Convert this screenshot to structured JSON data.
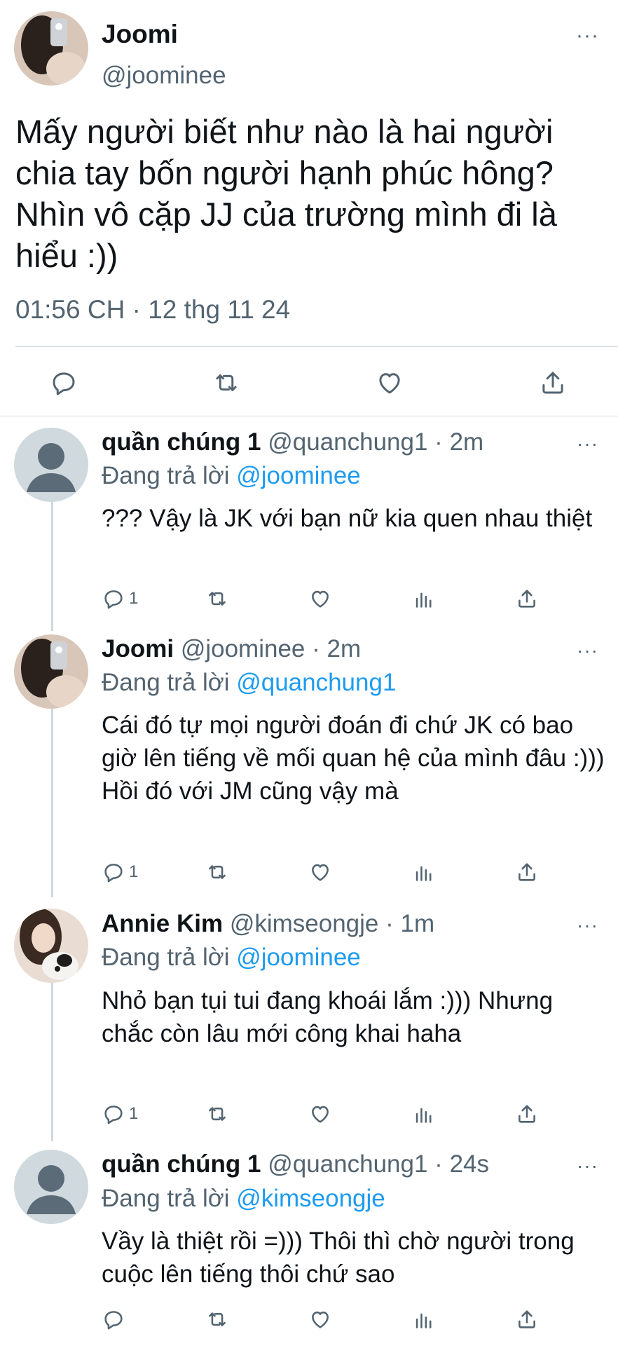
{
  "main_tweet": {
    "name": "Joomi",
    "handle": "@joominee",
    "more": "···",
    "text": "Mấy người biết như nào là hai người chia tay bốn người hạnh phúc hông? Nhìn vô cặp JJ của trường mình đi là hiểu :))",
    "meta": "01:56 CH · 12 thg 11 24",
    "actions": [
      "reply-icon",
      "retweet-icon",
      "like-icon",
      "share-icon"
    ]
  },
  "replies": [
    {
      "name": "quần chúng 1",
      "handle": "@quanchung1",
      "time": "2m",
      "replying_prefix": "Đang trả lời",
      "replying_to": "@joominee",
      "text": "??? Vậy là JK với bạn nữ kia quen nhau thiệt",
      "reply_count": "1"
    },
    {
      "name": "Joomi",
      "handle": "@joominee",
      "time": "2m",
      "replying_prefix": "Đang trả lời",
      "replying_to": "@quanchung1",
      "text": "Cái đó tự mọi người đoán đi chứ JK có bao giờ lên tiếng về mối quan hệ của mình đâu :))) Hồi đó với JM cũng vậy mà",
      "reply_count": "1"
    },
    {
      "name": "Annie Kim",
      "handle": "@kimseongje",
      "time": "1m",
      "replying_prefix": "Đang trả lời",
      "replying_to": "@joominee",
      "text": "Nhỏ bạn tụi tui đang khoái lắm :))) Nhưng chắc còn lâu mới công khai haha",
      "reply_count": "1"
    },
    {
      "name": "quần chúng 1",
      "handle": "@quanchung1",
      "time": "24s",
      "replying_prefix": "Đang trả lời",
      "replying_to": "@kimseongje",
      "text": "Vầy là thiệt rồi =))) Thôi thì chờ người trong cuộc lên tiếng thôi chứ sao",
      "reply_count": ""
    }
  ],
  "separator": " · ",
  "colors": {
    "link": "#1d9bf0",
    "muted": "#536471",
    "divider": "#cfd9de"
  }
}
